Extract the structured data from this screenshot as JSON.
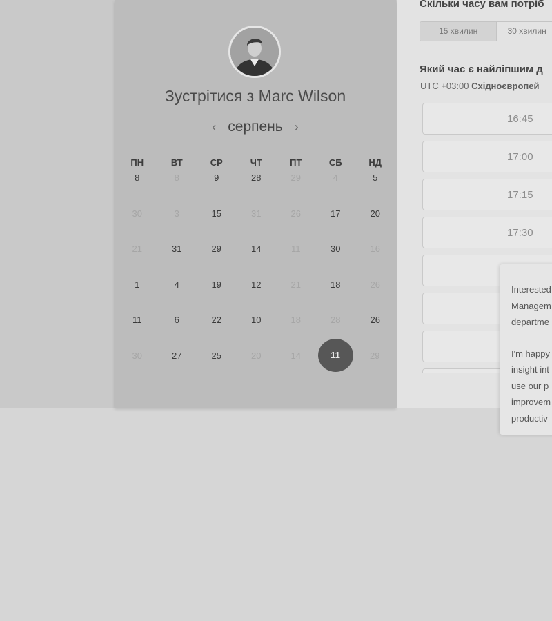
{
  "calendar": {
    "title": "Зустрітися з Marc Wilson",
    "month": "серпень",
    "weekdays": [
      "пн",
      "вт",
      "ср",
      "чт",
      "пт",
      "сб",
      "нд"
    ],
    "weeks": [
      [
        "8",
        "8",
        "9",
        "28",
        "29",
        "4",
        "5"
      ],
      [
        "30",
        "3",
        "15",
        "31",
        "26",
        "17",
        "20"
      ],
      [
        "21",
        "31",
        "29",
        "14",
        "11",
        "30",
        "16"
      ],
      [
        "1",
        "4",
        "19",
        "12",
        "21",
        "18",
        "26"
      ],
      [
        "11",
        "6",
        "22",
        "10",
        "18",
        "28",
        "26"
      ],
      [
        "30",
        "27",
        "25",
        "20",
        "14",
        "11",
        "29"
      ]
    ],
    "selected_day": "11"
  },
  "booking": {
    "duration_question": "Скільки часу вам потріб",
    "durations": [
      "15 хвилин",
      "30 хвилин"
    ],
    "time_question": "Який час є найліпшим д",
    "timezone_prefix": "UTC +03:00",
    "timezone_name": "Східноєвропей",
    "slots": [
      "16:45",
      "17:00",
      "17:15",
      "17:30",
      "",
      "",
      "",
      ""
    ]
  },
  "popup": {
    "lines_p1": [
      "Interested",
      "Managem",
      "departme"
    ],
    "lines_p2": [
      "I'm happy",
      "insight int",
      "use our p",
      "improvem",
      "productiv"
    ]
  }
}
